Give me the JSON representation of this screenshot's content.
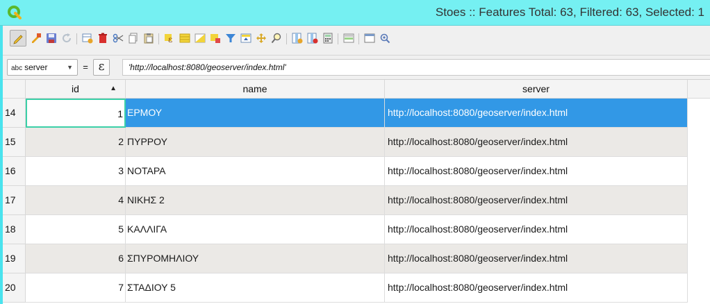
{
  "window": {
    "title": "Stoes :: Features Total: 63, Filtered: 63, Selected: 1",
    "logo_icon": "qgis-logo-icon"
  },
  "toolbar": {
    "buttons": [
      {
        "name": "toggle-editing",
        "icon": "pencil-icon",
        "active": true
      },
      {
        "name": "toggle-multi-edit",
        "icon": "multi-edit-pencil-icon"
      },
      {
        "name": "save-edits",
        "icon": "save-disk-icon"
      },
      {
        "name": "reload-table",
        "icon": "refresh-icon"
      },
      {
        "name": "add-feature",
        "icon": "add-row-icon"
      },
      {
        "name": "delete-selected",
        "icon": "trash-icon"
      },
      {
        "name": "cut-selected",
        "icon": "scissors-icon"
      },
      {
        "name": "copy-selected",
        "icon": "copy-icon"
      },
      {
        "name": "paste-features",
        "icon": "paste-icon"
      },
      {
        "name": "select-by-expression",
        "icon": "select-expression-icon"
      },
      {
        "name": "select-all",
        "icon": "select-all-icon"
      },
      {
        "name": "invert-selection",
        "icon": "invert-selection-icon"
      },
      {
        "name": "deselect-all",
        "icon": "deselect-icon"
      },
      {
        "name": "filter-select",
        "icon": "filter-funnel-icon"
      },
      {
        "name": "move-selection-top",
        "icon": "move-to-top-icon"
      },
      {
        "name": "pan-to-selected",
        "icon": "pan-icon"
      },
      {
        "name": "zoom-to-selected",
        "icon": "zoom-magnifier-icon"
      },
      {
        "name": "new-field",
        "icon": "new-field-icon"
      },
      {
        "name": "delete-field",
        "icon": "delete-field-icon"
      },
      {
        "name": "field-calculator",
        "icon": "calculator-icon"
      },
      {
        "name": "conditional-formatting",
        "icon": "conditional-format-icon"
      },
      {
        "name": "dock-table",
        "icon": "dock-window-icon"
      },
      {
        "name": "actions",
        "icon": "actions-icon"
      }
    ]
  },
  "expression_bar": {
    "field_type_prefix": "abc",
    "field": "server",
    "operator": "=",
    "expression_button_glyph": "ε",
    "expression": "'http://localhost:8080/geoserver/index.html'"
  },
  "table": {
    "columns": [
      "id",
      "name",
      "server"
    ],
    "sorted_column": "id",
    "rows": [
      {
        "row_number": "14",
        "id": "1",
        "name": "ΕΡΜΟΥ",
        "server": "http://localhost:8080/geoserver/index.html",
        "selected": true
      },
      {
        "row_number": "15",
        "id": "2",
        "name": "ΠΥΡΡΟΥ",
        "server": "http://localhost:8080/geoserver/index.html"
      },
      {
        "row_number": "16",
        "id": "3",
        "name": "ΝΟΤΑΡΑ",
        "server": "http://localhost:8080/geoserver/index.html"
      },
      {
        "row_number": "17",
        "id": "4",
        "name": "ΝΙΚΗΣ 2",
        "server": "http://localhost:8080/geoserver/index.html"
      },
      {
        "row_number": "18",
        "id": "5",
        "name": "ΚΑΛΛΙΓΑ",
        "server": "http://localhost:8080/geoserver/index.html"
      },
      {
        "row_number": "19",
        "id": "6",
        "name": "ΣΠΥΡΟΜΗΛΙΟΥ",
        "server": "http://localhost:8080/geoserver/index.html"
      },
      {
        "row_number": "20",
        "id": "7",
        "name": "ΣΤΑΔΙΟΥ 5",
        "server": "http://localhost:8080/geoserver/index.html"
      }
    ]
  }
}
